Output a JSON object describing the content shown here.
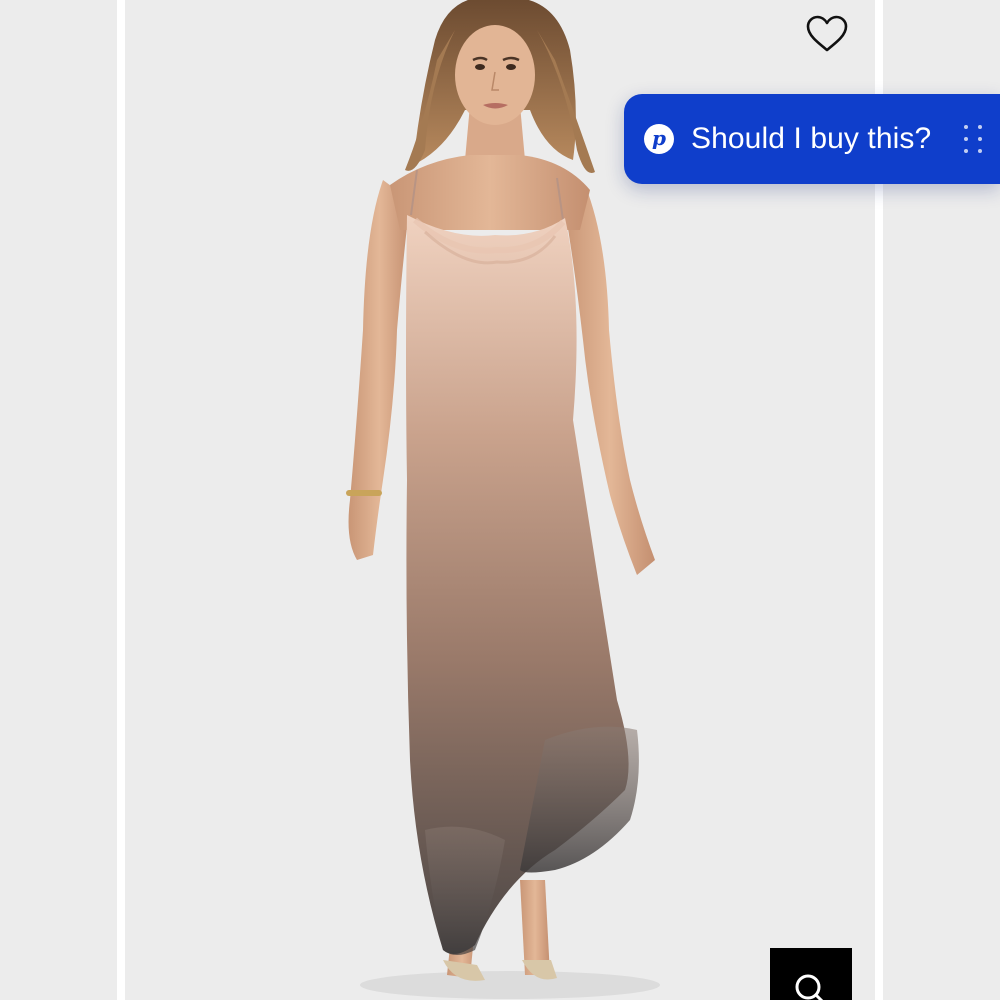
{
  "product": {
    "image_alt": "",
    "wishlist_icon": "heart-icon"
  },
  "assistant": {
    "label": "Should I buy this?",
    "logo_letter": "p",
    "logo_icon": "brand-logo-icon",
    "handle_icon": "drag-handle-icon",
    "color": "#0f3ecb"
  },
  "search": {
    "icon": "search-icon"
  }
}
